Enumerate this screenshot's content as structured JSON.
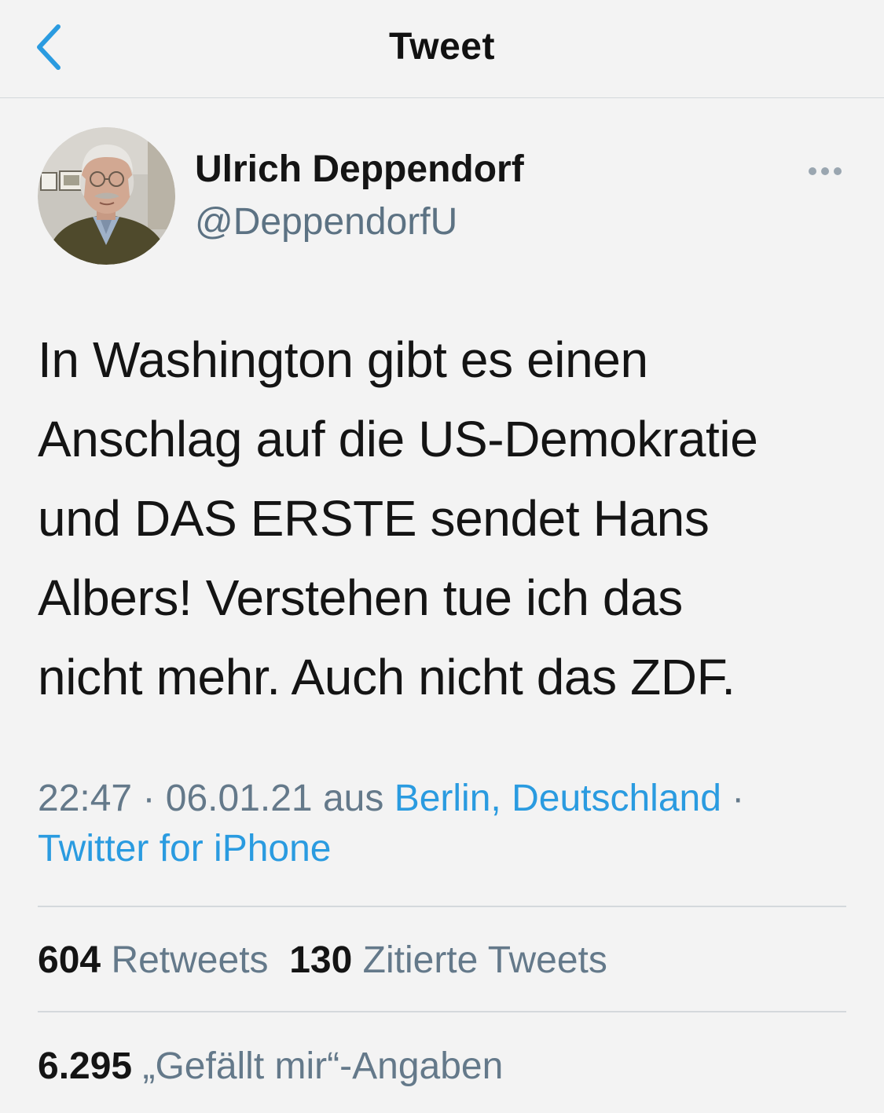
{
  "header": {
    "title": "Tweet",
    "back_icon": "chevron-left-icon",
    "accent_color": "#2a9be0"
  },
  "author": {
    "name": "Ulrich Deppendorf",
    "handle": "@DeppendorfU",
    "more_icon": "ellipsis-icon"
  },
  "tweet": {
    "lines": [
      "In Washington gibt es einen",
      "Anschlag auf die US-Demokratie",
      "und DAS ERSTE sendet Hans",
      "Albers! Verstehen tue ich das",
      "nicht mehr. Auch nicht das ZDF."
    ],
    "time": "22:47",
    "sep1": " · ",
    "date": "06.01.21",
    "from_label": " aus ",
    "location": "Berlin, Deutschland",
    "sep2": " ·",
    "source": "Twitter for iPhone"
  },
  "stats": {
    "retweets_count": "604",
    "retweets_label": "Retweets",
    "quotes_count": "130",
    "quotes_label": "Zitierte Tweets",
    "likes_count": "6.295",
    "likes_label": "„Gefällt mir“-Angaben"
  }
}
